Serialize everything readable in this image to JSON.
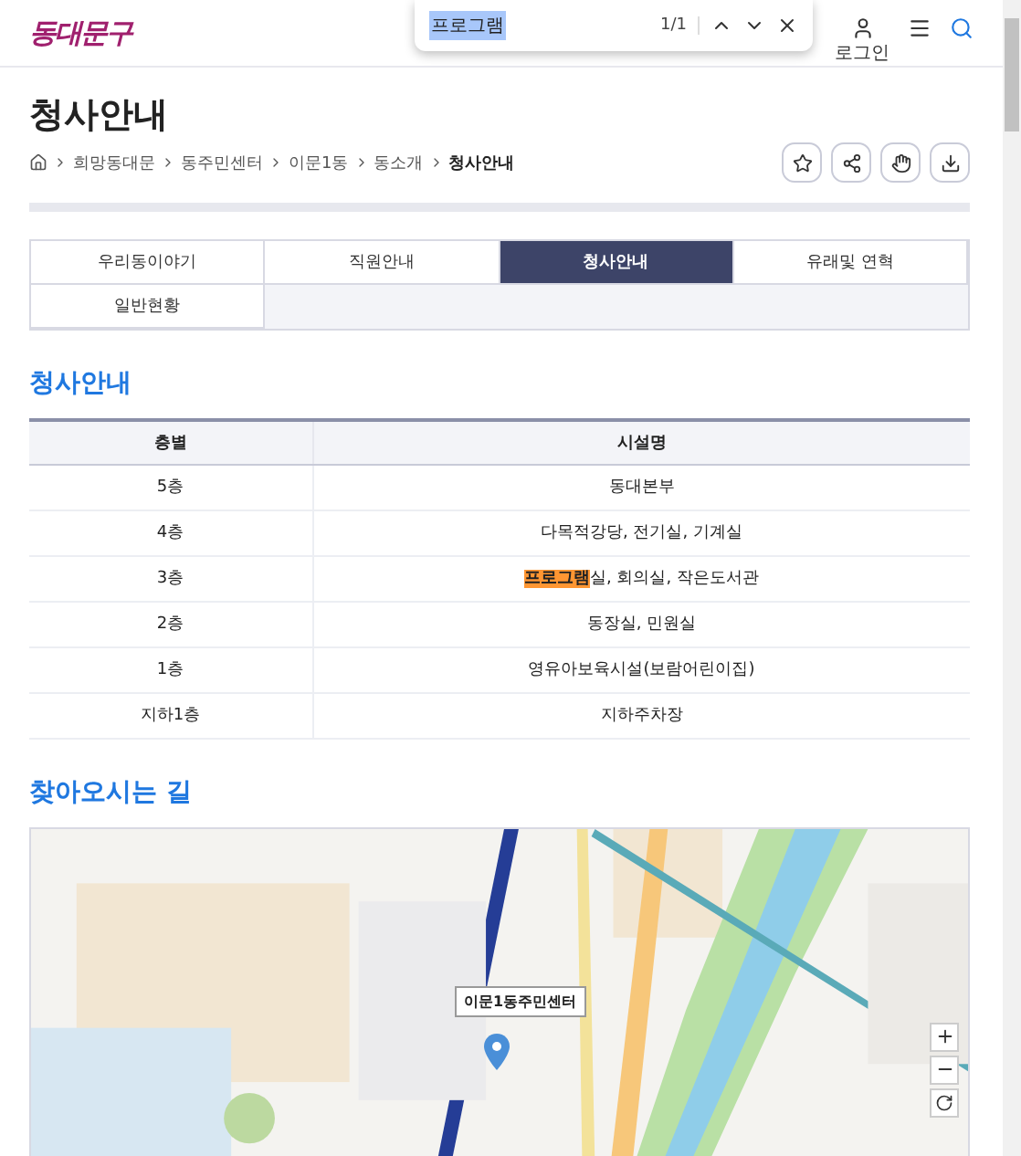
{
  "header": {
    "logo": "동대문구",
    "login": "로그인"
  },
  "find_bar": {
    "value": "프로그램",
    "count": "1/1"
  },
  "page": {
    "title": "청사안내",
    "breadcrumb": [
      "희망동대문",
      "동주민센터",
      "이문1동",
      "동소개",
      "청사안내"
    ]
  },
  "tabs": [
    {
      "label": "우리동이야기",
      "selected": false
    },
    {
      "label": "직원안내",
      "selected": false
    },
    {
      "label": "청사안내",
      "selected": true
    },
    {
      "label": "유래및 연혁",
      "selected": false
    },
    {
      "label": "일반현황",
      "selected": false
    }
  ],
  "section_title": "청사안내",
  "table": {
    "columns": [
      "층별",
      "시설명"
    ],
    "rows": [
      {
        "floor": "5층",
        "facilities": [
          {
            "text": "동대본부",
            "highlighted": false
          }
        ]
      },
      {
        "floor": "4층",
        "facilities": [
          {
            "text": "다목적강당, 전기실, 기계실",
            "highlighted": false
          }
        ]
      },
      {
        "floor": "3층",
        "facilities": [
          {
            "text": "프로그램",
            "highlighted": true
          },
          {
            "text": "실, 회의실, 작은도서관",
            "highlighted": false
          }
        ]
      },
      {
        "floor": "2층",
        "facilities": [
          {
            "text": "동장실, 민원실",
            "highlighted": false
          }
        ]
      },
      {
        "floor": "1층",
        "facilities": [
          {
            "text": "영유아보육시설(보람어린이집)",
            "highlighted": false
          }
        ]
      },
      {
        "floor": "지하1층",
        "facilities": [
          {
            "text": "지하주차장",
            "highlighted": false
          }
        ]
      }
    ]
  },
  "directions_title": "찾아오시는 길",
  "map": {
    "kind": "picture",
    "marker_label": "이문1동주민센터"
  }
}
